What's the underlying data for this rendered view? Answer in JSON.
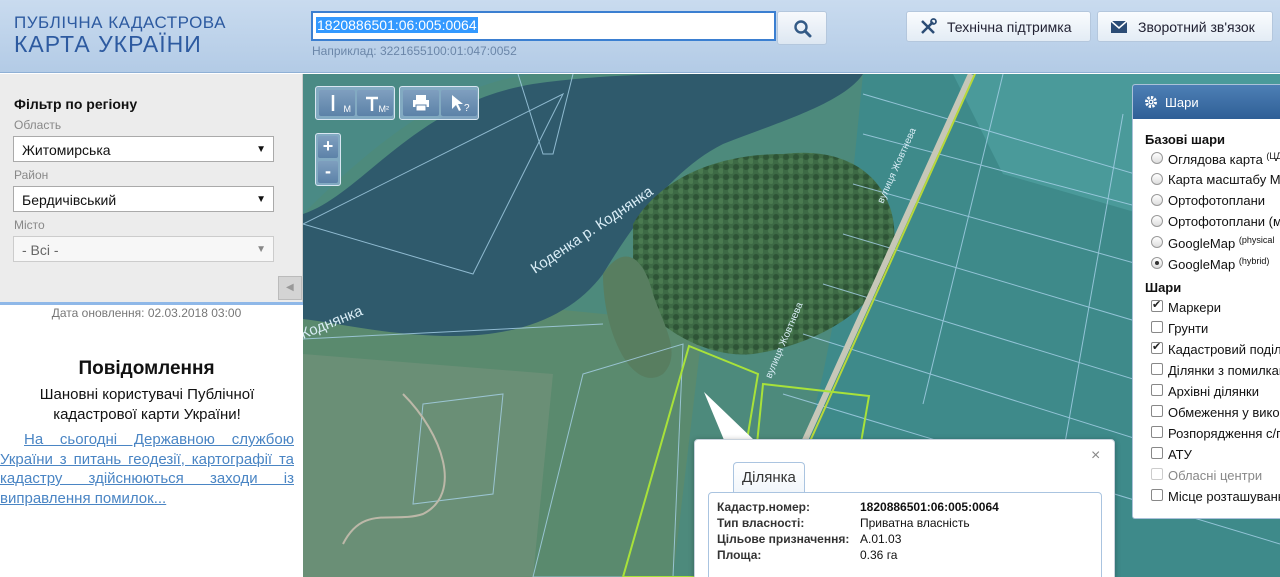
{
  "header": {
    "logo_line1": "ПУБЛІЧНА КАДАСТРОВА",
    "logo_line2": "КАРТА УКРАЇНИ",
    "search_value": "1820886501:06:005:0064",
    "search_hint": "Наприклад: 3221655100:01:047:0052",
    "support_label": "Технічна підтримка",
    "feedback_label": "Зворотний зв'язок"
  },
  "filter": {
    "title": "Фільтр по регіону",
    "region_label": "Область",
    "region_value": "Житомирська",
    "district_label": "Район",
    "district_value": "Бердичівський",
    "city_label": "Місто",
    "city_value": "- Всі -"
  },
  "updated": "Дата оновлення: 02.03.2018 03:00",
  "notice": {
    "title": "Повідомлення",
    "greeting": "Шановні користувачі Публічної кадастрової карти України!",
    "link_text": "На сьогодні Державною службою України з питань геодезії, картографії та кадастру здійснюються заходи із виправлення помилок..."
  },
  "map": {
    "toolbar": {
      "measure_line_sub": "M",
      "measure_area_sub": "M²"
    },
    "zoom_in": "+",
    "zoom_out": "-",
    "labels": {
      "river1": "Коденка р. Коднянка",
      "river2": "Коднянка",
      "street1": "вулиця Жовтнева",
      "street2": "вулиця Жовтнева"
    }
  },
  "layers": {
    "title": "Шари",
    "base_title": "Базові шари",
    "base": [
      {
        "label": "Оглядова карта",
        "sup": "(ЦД",
        "selected": false
      },
      {
        "label": "Карта масштабу М",
        "sup": "",
        "selected": false
      },
      {
        "label": "Ортофотоплани",
        "sup": "",
        "selected": false
      },
      {
        "label": "Ортофотоплани (м",
        "sup": "",
        "selected": false
      },
      {
        "label": "GoogleMap",
        "sup": "(physical",
        "selected": false
      },
      {
        "label": "GoogleMap",
        "sup": "(hybrid)",
        "selected": true
      }
    ],
    "layers_title": "Шари",
    "items": [
      {
        "label": "Маркери",
        "checked": true,
        "disabled": false
      },
      {
        "label": "Грунти",
        "checked": false,
        "disabled": false
      },
      {
        "label": "Кадастровий поділ",
        "checked": true,
        "disabled": false
      },
      {
        "label": "Ділянки з помилкам",
        "checked": false,
        "disabled": false
      },
      {
        "label": "Архівні ділянки",
        "checked": false,
        "disabled": false
      },
      {
        "label": "Обмеження у викор",
        "checked": false,
        "disabled": false
      },
      {
        "label": "Розпорядження с/г",
        "checked": false,
        "disabled": false
      },
      {
        "label": "АТУ",
        "checked": false,
        "disabled": false
      },
      {
        "label": "Обласні центри",
        "checked": false,
        "disabled": true
      },
      {
        "label": "Місце розташуванн",
        "checked": false,
        "disabled": false
      }
    ]
  },
  "popup": {
    "tab": "Ділянка",
    "close": "×",
    "rows": [
      {
        "key": "Кадастр.номер:",
        "value": "1820886501:06:005:0064"
      },
      {
        "key": "Тип власності:",
        "value": "Приватна власність"
      },
      {
        "key": "Цільове призначення:",
        "value": "А.01.03"
      },
      {
        "key": "Площа:",
        "value": "0.36 га"
      }
    ]
  }
}
